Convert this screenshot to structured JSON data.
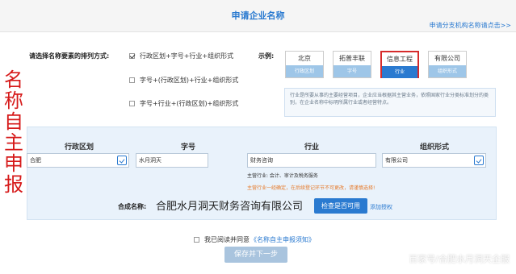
{
  "header": {
    "title": "申请企业名称",
    "branch_link": "申请分支机构名称请点击>>"
  },
  "side_chars": [
    "名",
    "称",
    "自",
    "主",
    "申",
    "报"
  ],
  "order": {
    "label": "请选择名称要素的排列方式:",
    "options": [
      {
        "label": "行政区划+字号+行业+组织形式",
        "checked": true
      },
      {
        "label": "字号+(行政区划)+行业+组织形式",
        "checked": false
      },
      {
        "label": "字号+行业+(行政区划)+组织形式",
        "checked": false
      }
    ]
  },
  "example": {
    "label": "示例:",
    "items": [
      {
        "top": "北京",
        "bottom": "行政区划",
        "active": false
      },
      {
        "top": "拓普丰联",
        "bottom": "字号",
        "active": false
      },
      {
        "top": "信息工程",
        "bottom": "行业",
        "active": true
      },
      {
        "top": "有限公司",
        "bottom": "组织形式",
        "active": false
      }
    ],
    "description": "行业是所要从事的主要经营项目，企业应当根据其主营业务，依照国家行业分类标准划分的类别，在企业名称中标明所属行业或者经营特点。"
  },
  "form": {
    "columns": [
      "行政区划",
      "字号",
      "行业",
      "组织形式"
    ],
    "values": {
      "region": "合肥",
      "trade_name": "水月洞天",
      "industry": "财务咨询",
      "org_form": "有限公司"
    },
    "industry_main": "主营行业: 会计、审计及税务服务",
    "industry_note": "主营行业一经确定，在后续登记环节不可更改，请谨慎选择!",
    "combined_label": "合成名称:",
    "combined_value": "合肥水月洞天财务咨询有限公司",
    "check_button": "检查是否可用",
    "add_auth": "添加授权"
  },
  "footer": {
    "agree_prefix": "我已阅读并同意",
    "agree_link": "《名称自主申报须知》",
    "next_button": "保存并下一步",
    "watermark": "百家号/合肥水月洞天企服"
  },
  "colors": {
    "accent": "#2a7ad0",
    "side_text": "#d61a1a",
    "warning": "#e67a2a"
  }
}
